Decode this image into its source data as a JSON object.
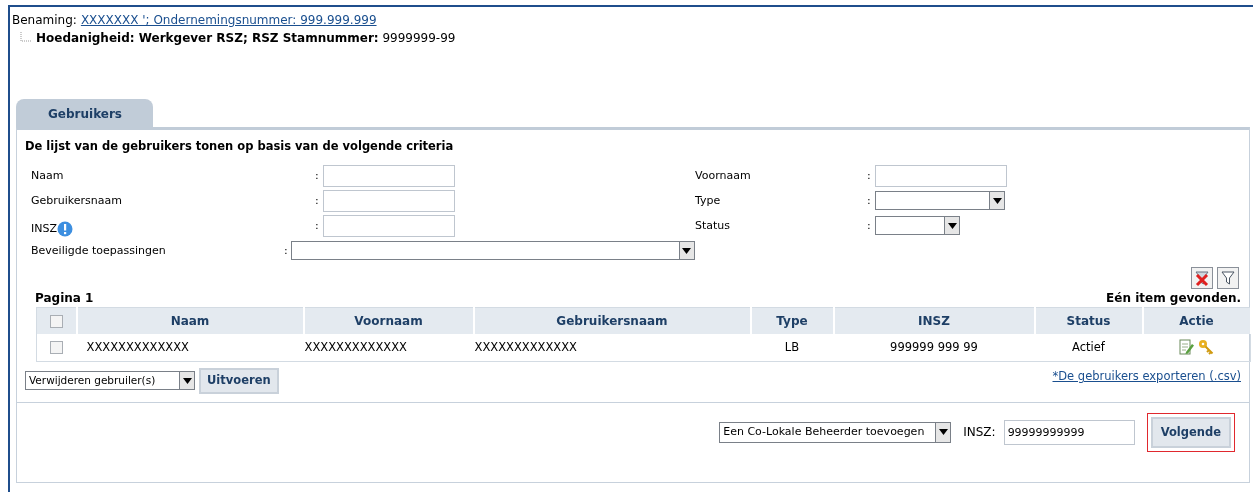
{
  "header": {
    "label": "Benaming:",
    "link": "XXXXXXX ';  Ondernemingsnummer: 999.999.999",
    "detail": "**Hoedanigheid: Werkgever RSZ; RSZ Stamnummer:** 9999999-99"
  },
  "tabs": [
    {
      "label": "Gebruikers",
      "selected": true
    }
  ],
  "criteria": {
    "title": "De lijst van de gebruikers tonen op basis van de volgende criteria",
    "left_fields": [
      {
        "label": "Naam",
        "colon": ":",
        "kind": "text"
      },
      {
        "label": "Gebruikersnaam",
        "colon": ":",
        "kind": "text"
      },
      {
        "label": "INSZ",
        "colon": ":",
        "kind": "text",
        "info": true
      },
      {
        "label": "Beveiligde toepassingen",
        "colon": ":",
        "kind": "wide-select"
      }
    ],
    "right_fields": [
      {
        "label": "Voornaam",
        "colon": ":",
        "kind": "text"
      },
      {
        "label": "Type",
        "colon": ":",
        "kind": "select"
      },
      {
        "label": "Status",
        "colon": ":",
        "kind": "short-select"
      }
    ]
  },
  "table": {
    "page": "Pagina 1",
    "count": "Eén item gevonden.",
    "header_checked": false,
    "columns": [
      "Naam",
      "Voornaam",
      "Gebruikersnaam",
      "Type",
      "INSZ",
      "Status",
      "Actie"
    ],
    "rows": [
      {
        "checked": false,
        "cells": [
          "XXXXXXXXXXXXX",
          "XXXXXXXXXXXXX",
          "XXXXXXXXXXXXX",
          "LB",
          "999999 999 99",
          "Actief"
        ]
      }
    ]
  },
  "bulk": {
    "action": "Verwijderen gebruiler(s)",
    "button": "Uitvoeren",
    "export_link": "*De gebruikers exporteren (.csv)"
  },
  "footer": {
    "action": "Een Co-Lokale Beheerder toevoegen",
    "insz_label": "INSZ:",
    "insz_value": "99999999999",
    "button": "Volgende",
    "highlighted": true
  }
}
